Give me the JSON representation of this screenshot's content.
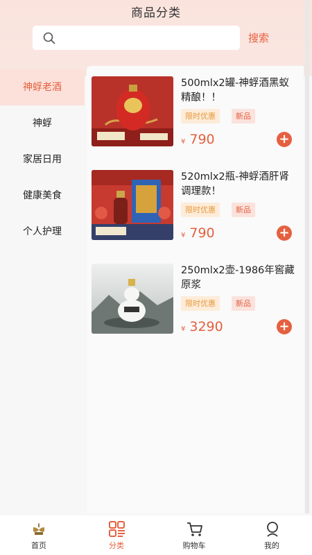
{
  "header": {
    "title": "商品分类",
    "search_placeholder": "",
    "search_button": "搜索"
  },
  "sidebar": {
    "items": [
      {
        "label": "神蜉老酒",
        "active": true
      },
      {
        "label": "神蜉",
        "active": false
      },
      {
        "label": "家居日用",
        "active": false
      },
      {
        "label": "健康美食",
        "active": false
      },
      {
        "label": "个人护理",
        "active": false
      }
    ]
  },
  "products": [
    {
      "title": "500mlx2罐-神蜉酒黑蚁精酿！！",
      "tags": [
        "限时优惠",
        "新品"
      ],
      "currency": "¥",
      "price": "790"
    },
    {
      "title": "520mlx2瓶-神蜉酒肝肾调理款！",
      "tags": [
        "限时优惠",
        "新品"
      ],
      "currency": "¥",
      "price": "790"
    },
    {
      "title": "250mlx2壶-1986年窖藏原浆",
      "tags": [
        "限时优惠",
        "新品"
      ],
      "currency": "¥",
      "price": "3290"
    }
  ],
  "tabbar": [
    {
      "label": "首页",
      "icon": "home-logo-icon",
      "active": false
    },
    {
      "label": "分类",
      "icon": "category-icon",
      "active": true
    },
    {
      "label": "购物车",
      "icon": "cart-icon",
      "active": false
    },
    {
      "label": "我的",
      "icon": "user-icon",
      "active": false
    }
  ],
  "colors": {
    "accent": "#e5603f",
    "tag_limit": "#e79a3f",
    "header_bg": "#fbe3dd"
  }
}
